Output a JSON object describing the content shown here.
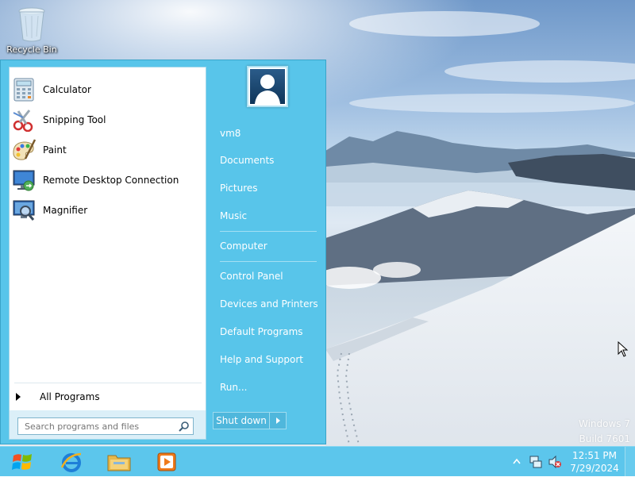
{
  "desktop": {
    "recycle_bin_label": "Recycle Bin",
    "watermark": {
      "line1": "Windows 7",
      "line2": "Build 7601"
    }
  },
  "start_menu": {
    "programs": [
      {
        "label": "Calculator",
        "icon": "calculator-icon"
      },
      {
        "label": "Snipping Tool",
        "icon": "scissors-icon"
      },
      {
        "label": "Paint",
        "icon": "paint-palette-icon"
      },
      {
        "label": "Remote Desktop Connection",
        "icon": "remote-desktop-icon"
      },
      {
        "label": "Magnifier",
        "icon": "magnifier-icon"
      }
    ],
    "all_programs_label": "All Programs",
    "search_placeholder": "Search programs and files",
    "right_items": {
      "user": "vm8",
      "documents": "Documents",
      "pictures": "Pictures",
      "music": "Music",
      "computer": "Computer",
      "control_panel": "Control Panel",
      "devices_printers": "Devices and Printers",
      "default_programs": "Default Programs",
      "help_support": "Help and Support",
      "run": "Run..."
    },
    "shutdown_label": "Shut down"
  },
  "taskbar": {
    "pinned": [
      "windows-start-icon",
      "internet-explorer-icon",
      "file-explorer-icon",
      "media-player-icon"
    ],
    "clock": {
      "time": "12:51 PM",
      "date": "7/29/2024"
    }
  },
  "colors": {
    "accent": "#58c5ea",
    "taskbar": "#5cc6ec"
  }
}
